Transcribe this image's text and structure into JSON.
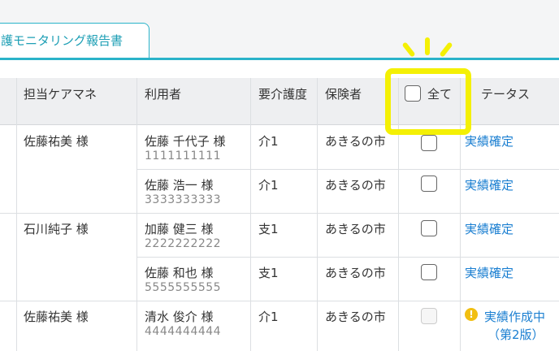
{
  "tab": {
    "label": "護モニタリング報告書"
  },
  "headers": {
    "manager": "担当ケアマネ",
    "user": "利用者",
    "care_level": "要介護度",
    "insurer": "保険者",
    "select_all": "全て",
    "status": "テータス"
  },
  "rows": [
    {
      "manager": "佐藤祐美 様",
      "user": "佐藤 千代子 様",
      "id": "1111111111",
      "care": "介1",
      "insurer": "あきるの市",
      "status": "実績確定"
    },
    {
      "manager": "",
      "user": "佐藤 浩一 様",
      "id": "3333333333",
      "care": "介1",
      "insurer": "あきるの市",
      "status": "実績確定"
    },
    {
      "manager": "石川純子 様",
      "user": "加藤 健三 様",
      "id": "2222222222",
      "care": "支1",
      "insurer": "あきるの市",
      "status": "実績確定"
    },
    {
      "manager": "",
      "user": "佐藤 和也 様",
      "id": "5555555555",
      "care": "支1",
      "insurer": "あきるの市",
      "status": "実績確定"
    },
    {
      "manager": "佐藤祐美 様",
      "user": "清水 俊介 様",
      "id": "4444444444",
      "care": "介1",
      "insurer": "あきるの市",
      "status": "実績作成中",
      "status2": "（第2版）"
    }
  ],
  "colors": {
    "accent": "#2ab3c9",
    "link": "#1b7fd1",
    "highlight": "#f4f005",
    "warning": "#f1bf12"
  },
  "icons": {
    "warning": "exclamation-icon"
  }
}
